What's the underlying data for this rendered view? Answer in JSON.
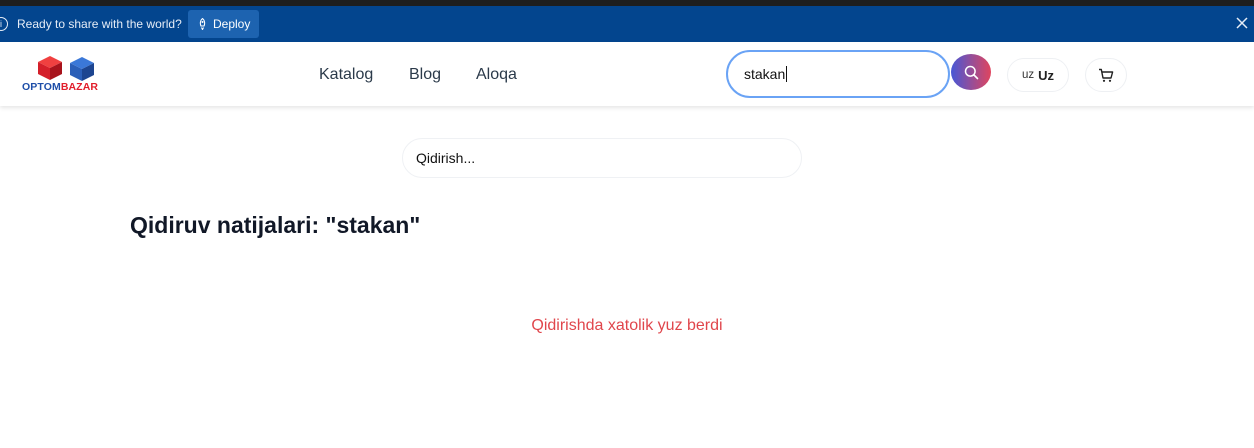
{
  "banner": {
    "message": "Ready to share with the world?",
    "deploy_label": "Deploy",
    "background": "#03458e"
  },
  "header": {
    "logo": {
      "part1": "OPTOM",
      "part2": "BAZAR",
      "colors": {
        "blue": "#1e4ea8",
        "red": "#e11d2a"
      }
    },
    "nav": [
      {
        "label": "Katalog"
      },
      {
        "label": "Blog"
      },
      {
        "label": "Aloqa"
      }
    ],
    "search": {
      "value": "stakan"
    },
    "language": {
      "code": "uz",
      "name": "Uz"
    },
    "icons": {
      "search": "search-icon",
      "cart": "cart-icon"
    }
  },
  "main": {
    "search_placeholder": "Qidirish...",
    "results_title": "Qidiruv natijalari: \"stakan\"",
    "error_message": "Qidirishda xatolik yuz berdi",
    "error_color": "#e0464c"
  }
}
